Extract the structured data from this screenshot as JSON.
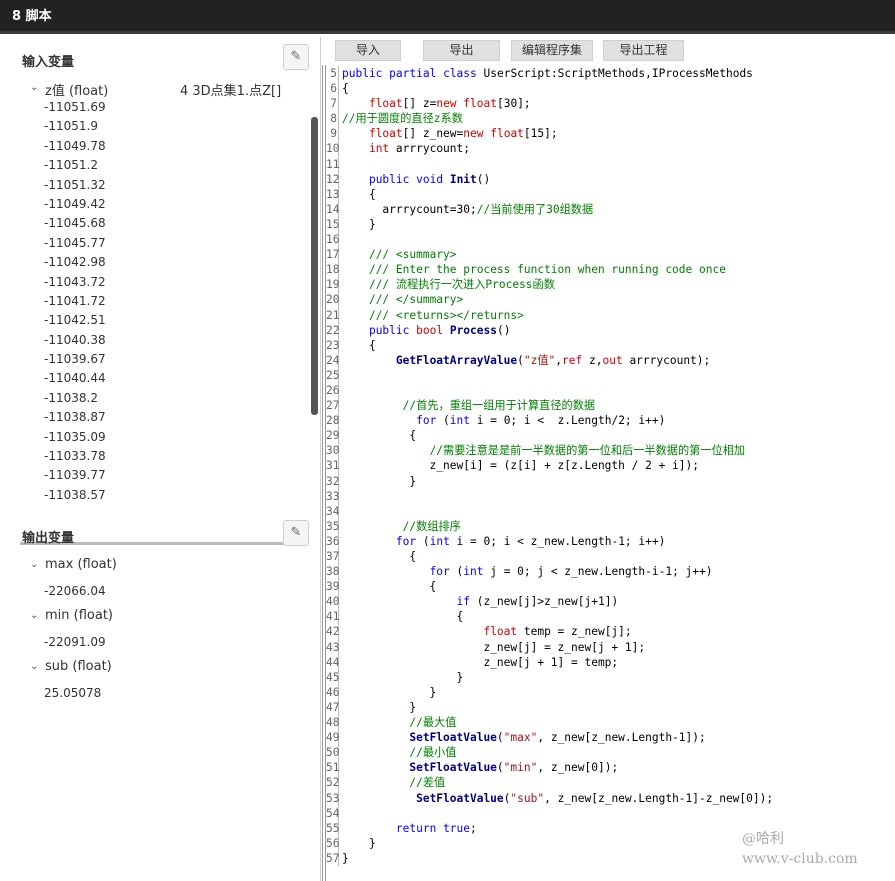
{
  "window": {
    "title": "8 脚本"
  },
  "input": {
    "title": "输入变量",
    "edit_icon": "pencil-icon",
    "var_name": "z值 (float)",
    "var_source": "4 3D点集1.点Z[]",
    "values": [
      "-11051.69",
      "-11051.9",
      "-11049.78",
      "-11051.2",
      "-11051.32",
      "-11049.42",
      "-11045.68",
      "-11045.77",
      "-11042.98",
      "-11043.72",
      "-11041.72",
      "-11042.51",
      "-11040.38",
      "-11039.67",
      "-11040.44",
      "-11038.2",
      "-11038.87",
      "-11035.09",
      "-11033.78",
      "-11039.77",
      "-11038.57"
    ]
  },
  "output": {
    "title": "输出变量",
    "edit_icon": "pencil-icon",
    "vars": [
      {
        "name": "max (float)",
        "value": "-22066.04"
      },
      {
        "name": "min (float)",
        "value": "-22091.09"
      },
      {
        "name": "sub (float)",
        "value": "25.05078"
      }
    ]
  },
  "toolbar": {
    "import": "导入",
    "export": "导出",
    "edit_set": "编辑程序集",
    "export_project": "导出工程"
  },
  "code": {
    "lines": [
      {
        "n": "5",
        "h": "<span class=\"kw\">public</span> <span class=\"kw\">partial</span> <span class=\"kw\">class</span> UserScript:ScriptMethods,IProcessMethods"
      },
      {
        "n": "6",
        "h": "{"
      },
      {
        "n": "7",
        "h": "    <span class=\"ty\">float</span>[] z=<span class=\"ty\">new</span> <span class=\"ty\">float</span>[30];"
      },
      {
        "n": "8",
        "h": "<span class=\"cm\">//用于圆度的直径z系数</span>"
      },
      {
        "n": "9",
        "h": "    <span class=\"ty\">float</span>[] z_new=<span class=\"ty\">new</span> <span class=\"ty\">float</span>[15];"
      },
      {
        "n": "10",
        "h": "    <span class=\"ty\">int</span> arrrycount;"
      },
      {
        "n": "11",
        "h": ""
      },
      {
        "n": "12",
        "h": "    <span class=\"kw\">public</span> <span class=\"kw\">void</span> <span class=\"fn\">Init</span>()"
      },
      {
        "n": "13",
        "h": "    {"
      },
      {
        "n": "14",
        "h": "      arrrycount=30;<span class=\"cm\">//当前使用了30组数据</span>"
      },
      {
        "n": "15",
        "h": "    }"
      },
      {
        "n": "16",
        "h": ""
      },
      {
        "n": "17",
        "h": "    <span class=\"cm\">/// &lt;summary&gt;</span>"
      },
      {
        "n": "18",
        "h": "    <span class=\"cm\">/// Enter the process function when running code once</span>"
      },
      {
        "n": "19",
        "h": "    <span class=\"cm\">/// 流程执行一次进入Process函数</span>"
      },
      {
        "n": "20",
        "h": "    <span class=\"cm\">/// &lt;/summary&gt;</span>"
      },
      {
        "n": "21",
        "h": "    <span class=\"cm\">/// &lt;returns&gt;&lt;/returns&gt;</span>"
      },
      {
        "n": "22",
        "h": "    <span class=\"kw\">public</span> <span class=\"ty\">bool</span> <span class=\"fn\">Process</span>()"
      },
      {
        "n": "23",
        "h": "    {"
      },
      {
        "n": "24",
        "h": "        <span class=\"fn\">GetFloatArrayValue</span>(<span class=\"st\">\"z值\"</span>,<span class=\"ty\">ref</span> z,<span class=\"ty\">out</span> arrrycount);"
      },
      {
        "n": "25",
        "h": ""
      },
      {
        "n": "26",
        "h": ""
      },
      {
        "n": "27",
        "h": "         <span class=\"cm\">//首先，重组一组用于计算直径的数据</span>"
      },
      {
        "n": "28",
        "h": "           <span class=\"kw\">for</span> (<span class=\"kw\">int</span> i = 0; i <  z.Length/2; i++)"
      },
      {
        "n": "29",
        "h": "          {"
      },
      {
        "n": "30",
        "h": "             <span class=\"cm\">//需要注意是是前一半数据的第一位和后一半数据的第一位相加</span>"
      },
      {
        "n": "31",
        "h": "             z_new[i] = (z[i] + z[z.Length / 2 + i]);"
      },
      {
        "n": "32",
        "h": "          }"
      },
      {
        "n": "33",
        "h": ""
      },
      {
        "n": "34",
        "h": ""
      },
      {
        "n": "35",
        "h": "         <span class=\"cm\">//数组排序</span>"
      },
      {
        "n": "36",
        "h": "        <span class=\"kw\">for</span> (<span class=\"kw\">int</span> i = 0; i < z_new.Length-1; i++)"
      },
      {
        "n": "37",
        "h": "          {"
      },
      {
        "n": "38",
        "h": "             <span class=\"kw\">for</span> (<span class=\"kw\">int</span> j = 0; j < z_new.Length-i-1; j++)"
      },
      {
        "n": "39",
        "h": "             {"
      },
      {
        "n": "40",
        "h": "                 <span class=\"kw\">if</span> (z_new[j]>z_new[j+1])"
      },
      {
        "n": "41",
        "h": "                 {"
      },
      {
        "n": "42",
        "h": "                     <span class=\"ty\">float</span> temp = z_new[j];"
      },
      {
        "n": "43",
        "h": "                     z_new[j] = z_new[j + 1];"
      },
      {
        "n": "44",
        "h": "                     z_new[j + 1] = temp;"
      },
      {
        "n": "45",
        "h": "                 }"
      },
      {
        "n": "46",
        "h": "             }"
      },
      {
        "n": "47",
        "h": "          }"
      },
      {
        "n": "48",
        "h": "          <span class=\"cm\">//最大值</span>"
      },
      {
        "n": "49",
        "h": "          <span class=\"fn\">SetFloatValue</span>(<span class=\"st\">\"max\"</span>, z_new[z_new.Length-1]);"
      },
      {
        "n": "50",
        "h": "          <span class=\"cm\">//最小值</span>"
      },
      {
        "n": "51",
        "h": "          <span class=\"fn\">SetFloatValue</span>(<span class=\"st\">\"min\"</span>, z_new[0]);"
      },
      {
        "n": "52",
        "h": "          <span class=\"cm\">//差值</span>"
      },
      {
        "n": "53",
        "h": "           <span class=\"fn\">SetFloatValue</span>(<span class=\"st\">\"sub\"</span>, z_new[z_new.Length-1]-z_new[0]);"
      },
      {
        "n": "54",
        "h": ""
      },
      {
        "n": "55",
        "h": "        <span class=\"kw\">return</span> <span class=\"kw\">true</span>;"
      },
      {
        "n": "56",
        "h": "    }"
      },
      {
        "n": "57",
        "h": "}"
      }
    ]
  },
  "watermark": {
    "author": "@哈利",
    "site": "www.v-club.com"
  }
}
